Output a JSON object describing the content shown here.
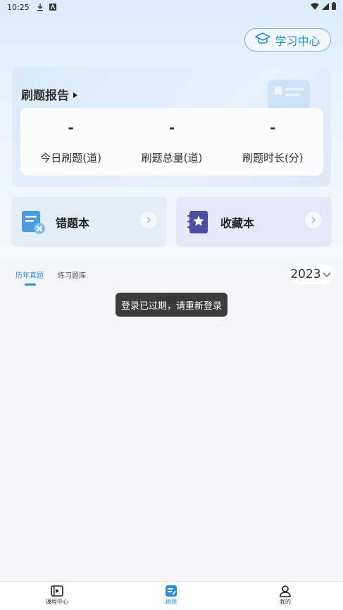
{
  "status_bar": {
    "time": "10:25"
  },
  "header": {
    "learn_center_label": "学习中心"
  },
  "report": {
    "title": "刷题报告",
    "stats": [
      {
        "value": "-",
        "label": "今日刷题(道)"
      },
      {
        "value": "-",
        "label": "刷题总量(道)"
      },
      {
        "value": "-",
        "label": "刷题时长(分)"
      }
    ]
  },
  "books": {
    "wrong_label": "错题本",
    "favorite_label": "收藏本"
  },
  "tabs": [
    {
      "label": "历年真题",
      "active": true
    },
    {
      "label": "练习题库",
      "active": false
    }
  ],
  "year_select": {
    "value": "2023"
  },
  "content": {
    "loading_text": "加载更多"
  },
  "toast": {
    "message": "登录已过期，请重新登录"
  },
  "bottom_nav": [
    {
      "label": "课程中心",
      "icon": "video-icon",
      "active": false
    },
    {
      "label": "刷题",
      "icon": "edit-icon",
      "active": true
    },
    {
      "label": "我的",
      "icon": "user-icon",
      "active": false
    }
  ],
  "colors": {
    "accent": "#2a8fd6",
    "background": "#f4f6f9"
  }
}
